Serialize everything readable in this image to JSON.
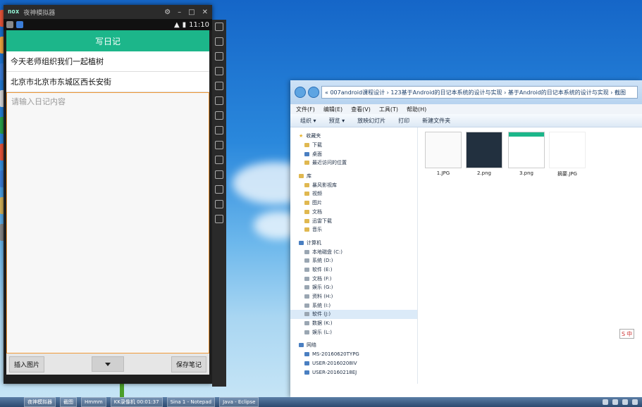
{
  "colors": {
    "app_accent": "#1cb68a",
    "textarea_border": "#f09a39",
    "desktop_sky": "#2a88dc"
  },
  "emulator": {
    "title": "夜神模拟器",
    "clock": "11:10",
    "app": {
      "title": "写日记",
      "title_field": "今天老师组织我们一起植树",
      "location_field": "北京市北京市东城区西长安街",
      "content_placeholder": "请输入日记内容",
      "insert_image_button": "插入图片",
      "save_button": "保存笔记"
    }
  },
  "explorer": {
    "address": "« 007android课程设计 › 123基于Android的日记本系统的设计与实现 › 基于Android的日记本系统的设计与实现 › 截图",
    "menu": [
      "文件(F)",
      "编辑(E)",
      "查看(V)",
      "工具(T)",
      "帮助(H)"
    ],
    "commands": [
      "组织 ▾",
      "预览 ▾",
      "放映幻灯片",
      "打印",
      "新建文件夹"
    ],
    "nav": {
      "favorites_label": "收藏夹",
      "favorites": [
        "下载",
        "桌面",
        "最近访问的位置"
      ],
      "library_label": "库",
      "libraries": [
        "暴风影视库",
        "视频",
        "图片",
        "文档",
        "迅雷下载",
        "音乐"
      ],
      "computer_label": "计算机",
      "drives": [
        "本地磁盘 (C:)",
        "系统 (D:)",
        "软件 (E:)",
        "文档 (F:)",
        "娱乐 (G:)",
        "资料 (H:)",
        "系统 (I:)",
        "软件 (J:)",
        "数据 (K:)",
        "娱乐 (L:)"
      ],
      "network_label": "网络",
      "network": [
        "MS-20160620TYPG",
        "USER-20160208IV",
        "USER-20160218EJ"
      ]
    },
    "files": [
      "1.JPG",
      "2.png",
      "3.png",
      "摘要.JPG"
    ]
  },
  "taskbar": {
    "tasks": [
      "夜神模拟器",
      "截图",
      "Hmmm",
      "KK录像机 00:01:37",
      "Sina 1 - Notepad",
      "Java - Eclipse"
    ]
  },
  "ime": "中"
}
